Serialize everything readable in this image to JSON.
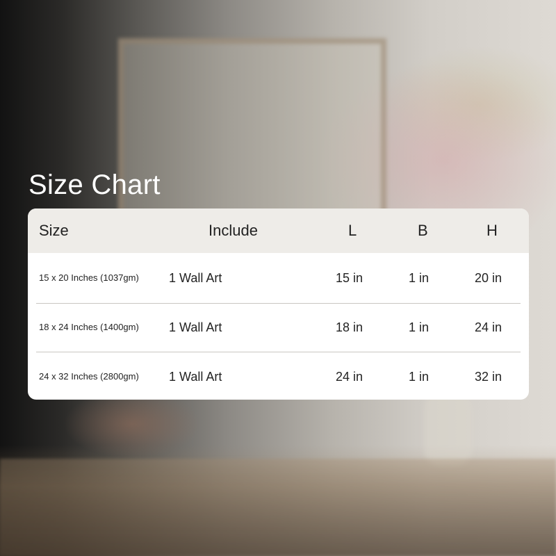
{
  "title": "Size Chart",
  "colors": {
    "title": "#ffffff",
    "header_bg": "#eeece8",
    "card_bg": "#ffffff",
    "text": "#222222"
  },
  "table": {
    "headers": {
      "size": "Size",
      "include": "Include",
      "l": "L",
      "b": "B",
      "h": "H"
    },
    "rows": [
      {
        "size": "15 x 20 Inches (1037gm)",
        "include": "1 Wall Art",
        "l": "15 in",
        "b": "1 in",
        "h": "20 in"
      },
      {
        "size": "18 x 24 Inches (1400gm)",
        "include": "1 Wall Art",
        "l": "18 in",
        "b": "1 in",
        "h": "24 in"
      },
      {
        "size": "24 x 32 Inches (2800gm)",
        "include": "1 Wall Art",
        "l": "24 in",
        "b": "1 in",
        "h": "32 in"
      }
    ]
  }
}
